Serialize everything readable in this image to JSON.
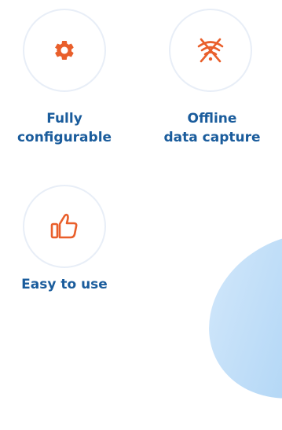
{
  "colors": {
    "accent": "#e95f2b",
    "text": "#1a5c9c",
    "circle_border": "#e8eef7",
    "blob": "#b3d7f6"
  },
  "features": [
    {
      "icon": "gear-icon",
      "label_lines": [
        "Fully",
        "configurable"
      ]
    },
    {
      "icon": "no-wifi-icon",
      "label_lines": [
        "Offline",
        "data capture"
      ]
    },
    {
      "icon": "thumbs-up-icon",
      "label_lines": [
        "Easy to use"
      ]
    }
  ]
}
